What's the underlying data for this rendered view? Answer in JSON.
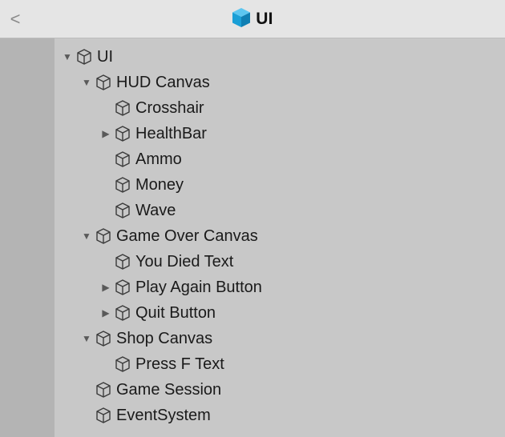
{
  "header": {
    "back_glyph": "<",
    "title": "UI",
    "title_icon": "prefab-cube-icon",
    "title_icon_color": "#1aa0d8"
  },
  "hierarchy": {
    "row_icon": "gameobject-cube-icon",
    "rows": [
      {
        "label": "UI",
        "depth": 0,
        "fold": "expanded"
      },
      {
        "label": "HUD Canvas",
        "depth": 1,
        "fold": "expanded"
      },
      {
        "label": "Crosshair",
        "depth": 2,
        "fold": "none"
      },
      {
        "label": "HealthBar",
        "depth": 2,
        "fold": "collapsed"
      },
      {
        "label": "Ammo",
        "depth": 2,
        "fold": "none"
      },
      {
        "label": "Money",
        "depth": 2,
        "fold": "none"
      },
      {
        "label": "Wave",
        "depth": 2,
        "fold": "none"
      },
      {
        "label": "Game Over Canvas",
        "depth": 1,
        "fold": "expanded"
      },
      {
        "label": "You Died Text",
        "depth": 2,
        "fold": "none"
      },
      {
        "label": "Play Again Button",
        "depth": 2,
        "fold": "collapsed"
      },
      {
        "label": "Quit Button",
        "depth": 2,
        "fold": "collapsed"
      },
      {
        "label": "Shop Canvas",
        "depth": 1,
        "fold": "expanded"
      },
      {
        "label": "Press F Text",
        "depth": 2,
        "fold": "none"
      },
      {
        "label": "Game Session",
        "depth": 1,
        "fold": "none"
      },
      {
        "label": "EventSystem",
        "depth": 1,
        "fold": "none"
      }
    ]
  }
}
